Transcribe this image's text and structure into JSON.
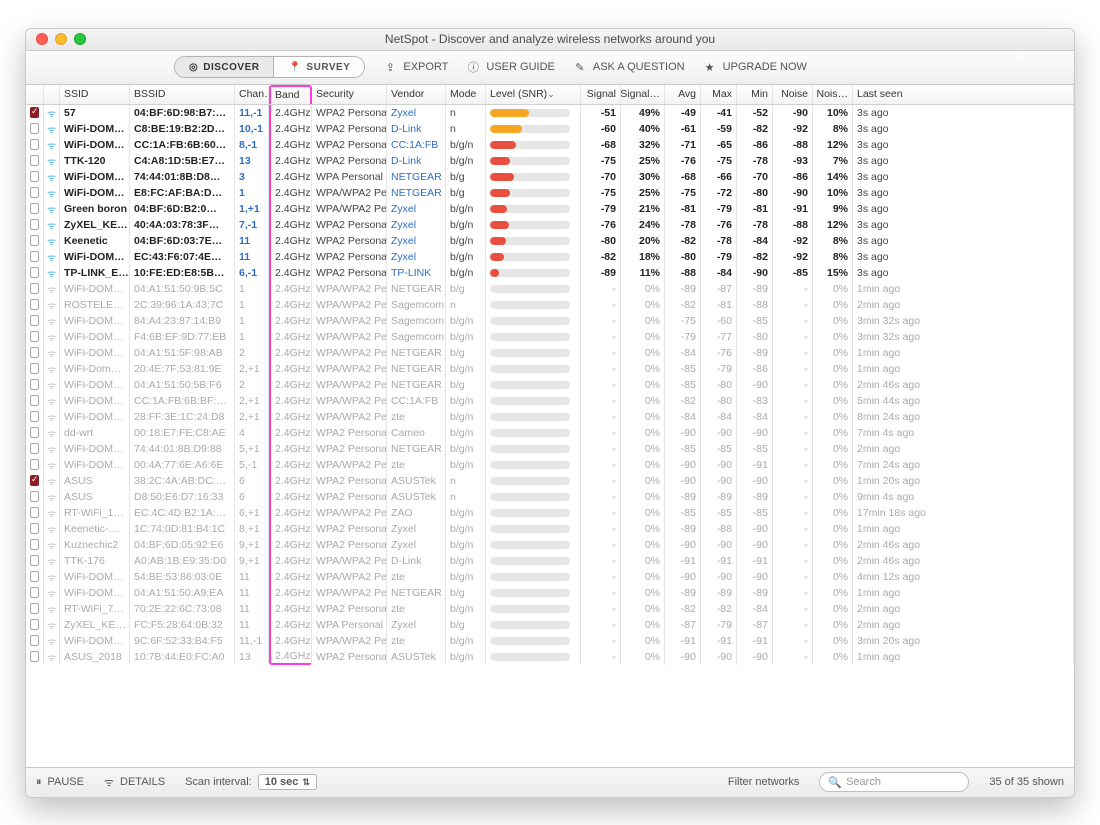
{
  "title": "NetSpot - Discover and analyze wireless networks around you",
  "toolbar": {
    "discover": "DISCOVER",
    "survey": "SURVEY",
    "export": "EXPORT",
    "userguide": "USER GUIDE",
    "ask": "ASK A QUESTION",
    "upgrade": "UPGRADE NOW"
  },
  "columns": {
    "ssid": "SSID",
    "bssid": "BSSID",
    "chan": "Chan…",
    "band": "Band",
    "security": "Security",
    "vendor": "Vendor",
    "mode": "Mode",
    "level": "Level (SNR)",
    "signal": "Signal",
    "signalp": "Signal…",
    "avg": "Avg",
    "max": "Max",
    "min": "Min",
    "noise": "Noise",
    "noisep": "Nois…",
    "last": "Last seen"
  },
  "footer": {
    "pause": "PAUSE",
    "details": "DETAILS",
    "scan_interval_label": "Scan interval:",
    "scan_interval_value": "10 sec",
    "filter_label": "Filter networks",
    "search_placeholder": "Search",
    "shown": "35 of 35 shown"
  },
  "rows": [
    {
      "chk": true,
      "ssid": "57",
      "bssid": "04:BF:6D:98:B7:…",
      "chan": "11,-1",
      "band": "2.4GHz",
      "sec": "WPA2 Personal",
      "vendor": "Zyxel",
      "mode": "n",
      "signal": -51,
      "spct": "49%",
      "avg": -49,
      "max": -41,
      "min": -52,
      "noise": -90,
      "noisep": "10%",
      "last": "3s ago",
      "active": true,
      "bar": 49,
      "color": "#f5a623"
    },
    {
      "chk": false,
      "ssid": "WiFi-DOM…",
      "bssid": "C8:BE:19:B2:2D…",
      "chan": "10,-1",
      "band": "2.4GHz",
      "sec": "WPA2 Personal",
      "vendor": "D-Link",
      "mode": "n",
      "signal": -60,
      "spct": "40%",
      "avg": -61,
      "max": -59,
      "min": -82,
      "noise": -92,
      "noisep": "8%",
      "last": "3s ago",
      "active": true,
      "bar": 40,
      "color": "#f5a623"
    },
    {
      "chk": false,
      "ssid": "WiFi-DOM…",
      "bssid": "CC:1A:FB:6B:60…",
      "chan": "8,-1",
      "band": "2.4GHz",
      "sec": "WPA2 Personal",
      "vendor": "CC:1A:FB",
      "mode": "b/g/n",
      "signal": -68,
      "spct": "32%",
      "avg": -71,
      "max": -65,
      "min": -86,
      "noise": -88,
      "noisep": "12%",
      "last": "3s ago",
      "active": true,
      "bar": 32,
      "color": "#e94f3e"
    },
    {
      "chk": false,
      "ssid": "TTK-120",
      "bssid": "C4:A8:1D:5B:E7…",
      "chan": "13",
      "band": "2.4GHz",
      "sec": "WPA2 Personal",
      "vendor": "D-Link",
      "mode": "b/g/n",
      "signal": -75,
      "spct": "25%",
      "avg": -76,
      "max": -75,
      "min": -78,
      "noise": -93,
      "noisep": "7%",
      "last": "3s ago",
      "active": true,
      "bar": 25,
      "color": "#e94f3e"
    },
    {
      "chk": false,
      "ssid": "WiFi-DOM…",
      "bssid": "74:44:01:8B:D8…",
      "chan": "3",
      "band": "2.4GHz",
      "sec": "WPA Personal",
      "vendor": "NETGEAR",
      "mode": "b/g",
      "signal": -70,
      "spct": "30%",
      "avg": -68,
      "max": -66,
      "min": -70,
      "noise": -86,
      "noisep": "14%",
      "last": "3s ago",
      "active": true,
      "bar": 30,
      "color": "#e94f3e"
    },
    {
      "chk": false,
      "ssid": "WiFi-DOM…",
      "bssid": "E8:FC:AF:BA:D…",
      "chan": "1",
      "band": "2.4GHz",
      "sec": "WPA/WPA2 Pe…",
      "vendor": "NETGEAR",
      "mode": "b/g",
      "signal": -75,
      "spct": "25%",
      "avg": -75,
      "max": -72,
      "min": -80,
      "noise": -90,
      "noisep": "10%",
      "last": "3s ago",
      "active": true,
      "bar": 25,
      "color": "#e94f3e"
    },
    {
      "chk": false,
      "ssid": "Green boron",
      "bssid": "04:BF:6D:B2:0…",
      "chan": "1,+1",
      "band": "2.4GHz",
      "sec": "WPA/WPA2 Pe…",
      "vendor": "Zyxel",
      "mode": "b/g/n",
      "signal": -79,
      "spct": "21%",
      "avg": -81,
      "max": -79,
      "min": -81,
      "noise": -91,
      "noisep": "9%",
      "last": "3s ago",
      "active": true,
      "bar": 21,
      "color": "#e94f3e"
    },
    {
      "chk": false,
      "ssid": "ZyXEL_KE…",
      "bssid": "40:4A:03:78:3F…",
      "chan": "7,-1",
      "band": "2.4GHz",
      "sec": "WPA2 Personal",
      "vendor": "Zyxel",
      "mode": "b/g/n",
      "signal": -76,
      "spct": "24%",
      "avg": -78,
      "max": -76,
      "min": -78,
      "noise": -88,
      "noisep": "12%",
      "last": "3s ago",
      "active": true,
      "bar": 24,
      "color": "#e94f3e"
    },
    {
      "chk": false,
      "ssid": "Keenetic",
      "bssid": "04:BF:6D:03:7E…",
      "chan": "11",
      "band": "2.4GHz",
      "sec": "WPA2 Personal",
      "vendor": "Zyxel",
      "mode": "b/g/n",
      "signal": -80,
      "spct": "20%",
      "avg": -82,
      "max": -78,
      "min": -84,
      "noise": -92,
      "noisep": "8%",
      "last": "3s ago",
      "active": true,
      "bar": 20,
      "color": "#e94f3e"
    },
    {
      "chk": false,
      "ssid": "WiFi-DOM…",
      "bssid": "EC:43:F6:07:4E…",
      "chan": "11",
      "band": "2.4GHz",
      "sec": "WPA2 Personal",
      "vendor": "Zyxel",
      "mode": "b/g/n",
      "signal": -82,
      "spct": "18%",
      "avg": -80,
      "max": -79,
      "min": -82,
      "noise": -92,
      "noisep": "8%",
      "last": "3s ago",
      "active": true,
      "bar": 18,
      "color": "#e94f3e"
    },
    {
      "chk": false,
      "ssid": "TP-LINK_E…",
      "bssid": "10:FE:ED:E8:5B…",
      "chan": "6,-1",
      "band": "2.4GHz",
      "sec": "WPA2 Personal",
      "vendor": "TP-LINK",
      "mode": "b/g/n",
      "signal": -89,
      "spct": "11%",
      "avg": -88,
      "max": -84,
      "min": -90,
      "noise": -85,
      "noisep": "15%",
      "last": "3s ago",
      "active": true,
      "bar": 11,
      "color": "#e94f3e"
    },
    {
      "chk": false,
      "ssid": "WiFi-DOM…",
      "bssid": "04:A1:51:50:9B:5C",
      "chan": "1",
      "band": "2.4GHz",
      "sec": "WPA/WPA2 Per…",
      "vendor": "NETGEAR",
      "mode": "b/g",
      "signal": "-",
      "spct": "0%",
      "avg": -89,
      "max": -87,
      "min": -89,
      "noise": "-",
      "noisep": "0%",
      "last": "1min ago",
      "active": false,
      "bar": 0
    },
    {
      "chk": false,
      "ssid": "ROSTELE…",
      "bssid": "2C:39:96:1A:43:7C",
      "chan": "1",
      "band": "2.4GHz",
      "sec": "WPA/WPA2 Per…",
      "vendor": "Sagemcom",
      "mode": "n",
      "signal": "-",
      "spct": "0%",
      "avg": -82,
      "max": -81,
      "min": -88,
      "noise": "-",
      "noisep": "0%",
      "last": "2min ago",
      "active": false,
      "bar": 0
    },
    {
      "chk": false,
      "ssid": "WiFi-DOM…",
      "bssid": "84:A4:23:87:14:B9",
      "chan": "1",
      "band": "2.4GHz",
      "sec": "WPA/WPA2 Per…",
      "vendor": "Sagemcom",
      "mode": "b/g/n",
      "signal": "-",
      "spct": "0%",
      "avg": -75,
      "max": -60,
      "min": -85,
      "noise": "-",
      "noisep": "0%",
      "last": "3min 32s ago",
      "active": false,
      "bar": 0
    },
    {
      "chk": false,
      "ssid": "WiFi-DOM…",
      "bssid": "F4:6B:EF:9D:77:EB",
      "chan": "1",
      "band": "2.4GHz",
      "sec": "WPA/WPA2 Per…",
      "vendor": "Sagemcom",
      "mode": "b/g/n",
      "signal": "-",
      "spct": "0%",
      "avg": -79,
      "max": -77,
      "min": -80,
      "noise": "-",
      "noisep": "0%",
      "last": "3min 32s ago",
      "active": false,
      "bar": 0
    },
    {
      "chk": false,
      "ssid": "WiFi-DOM…",
      "bssid": "04:A1:51:5F:98:AB",
      "chan": "2",
      "band": "2.4GHz",
      "sec": "WPA/WPA2 Per…",
      "vendor": "NETGEAR",
      "mode": "b/g",
      "signal": "-",
      "spct": "0%",
      "avg": -84,
      "max": -76,
      "min": -89,
      "noise": "-",
      "noisep": "0%",
      "last": "1min ago",
      "active": false,
      "bar": 0
    },
    {
      "chk": false,
      "ssid": "WiFi-Dom…",
      "bssid": "20:4E:7F:53:81:9E",
      "chan": "2,+1",
      "band": "2.4GHz",
      "sec": "WPA/WPA2 Per…",
      "vendor": "NETGEAR",
      "mode": "b/g/n",
      "signal": "-",
      "spct": "0%",
      "avg": -85,
      "max": -79,
      "min": -86,
      "noise": "-",
      "noisep": "0%",
      "last": "1min ago",
      "active": false,
      "bar": 0
    },
    {
      "chk": false,
      "ssid": "WiFi-DOM…",
      "bssid": "04:A1:51:50:5B:F6",
      "chan": "2",
      "band": "2.4GHz",
      "sec": "WPA/WPA2 Per…",
      "vendor": "NETGEAR",
      "mode": "b/g",
      "signal": "-",
      "spct": "0%",
      "avg": -85,
      "max": -80,
      "min": -90,
      "noise": "-",
      "noisep": "0%",
      "last": "2min 46s ago",
      "active": false,
      "bar": 0
    },
    {
      "chk": false,
      "ssid": "WiFi-DOM…",
      "bssid": "CC:1A:FB:6B:BF:…",
      "chan": "2,+1",
      "band": "2.4GHz",
      "sec": "WPA/WPA2 Per…",
      "vendor": "CC:1A:FB",
      "mode": "b/g/n",
      "signal": "-",
      "spct": "0%",
      "avg": -82,
      "max": -80,
      "min": -83,
      "noise": "-",
      "noisep": "0%",
      "last": "5min 44s ago",
      "active": false,
      "bar": 0
    },
    {
      "chk": false,
      "ssid": "WiFi-DOM…",
      "bssid": "28:FF:3E:1C:24:D8",
      "chan": "2,+1",
      "band": "2.4GHz",
      "sec": "WPA/WPA2 Per…",
      "vendor": "zte",
      "mode": "b/g/n",
      "signal": "-",
      "spct": "0%",
      "avg": -84,
      "max": -84,
      "min": -84,
      "noise": "-",
      "noisep": "0%",
      "last": "8min 24s ago",
      "active": false,
      "bar": 0
    },
    {
      "chk": false,
      "ssid": "dd-wrt",
      "bssid": "00:18:E7:FE:C8:AE",
      "chan": "4",
      "band": "2.4GHz",
      "sec": "WPA2 Personal",
      "vendor": "Cameo",
      "mode": "b/g/n",
      "signal": "-",
      "spct": "0%",
      "avg": -90,
      "max": -90,
      "min": -90,
      "noise": "-",
      "noisep": "0%",
      "last": "7min 4s ago",
      "active": false,
      "bar": 0
    },
    {
      "chk": false,
      "ssid": "WiFi-DOM…",
      "bssid": "74:44:01:8B:D9:88",
      "chan": "5,+1",
      "band": "2.4GHz",
      "sec": "WPA2 Personal",
      "vendor": "NETGEAR",
      "mode": "b/g/n",
      "signal": "-",
      "spct": "0%",
      "avg": -85,
      "max": -85,
      "min": -85,
      "noise": "-",
      "noisep": "0%",
      "last": "2min ago",
      "active": false,
      "bar": 0
    },
    {
      "chk": false,
      "ssid": "WiFi-DOM…",
      "bssid": "00:4A:77:6E:A6:6E",
      "chan": "5,-1",
      "band": "2.4GHz",
      "sec": "WPA/WPA2 Per…",
      "vendor": "zte",
      "mode": "b/g/n",
      "signal": "-",
      "spct": "0%",
      "avg": -90,
      "max": -90,
      "min": -91,
      "noise": "-",
      "noisep": "0%",
      "last": "7min 24s ago",
      "active": false,
      "bar": 0
    },
    {
      "chk": true,
      "ssid": "ASUS",
      "bssid": "38:2C:4A:AB:DC:…",
      "chan": "6",
      "band": "2.4GHz",
      "sec": "WPA2 Personal",
      "vendor": "ASUSTek",
      "mode": "n",
      "signal": "-",
      "spct": "0%",
      "avg": -90,
      "max": -90,
      "min": -90,
      "noise": "-",
      "noisep": "0%",
      "last": "1min 20s ago",
      "active": false,
      "bar": 0
    },
    {
      "chk": false,
      "ssid": "ASUS",
      "bssid": "D8:50:E6:D7:16:33",
      "chan": "6",
      "band": "2.4GHz",
      "sec": "WPA2 Personal",
      "vendor": "ASUSTek",
      "mode": "n",
      "signal": "-",
      "spct": "0%",
      "avg": -89,
      "max": -89,
      "min": -89,
      "noise": "-",
      "noisep": "0%",
      "last": "9min 4s ago",
      "active": false,
      "bar": 0
    },
    {
      "chk": false,
      "ssid": "RT-WiFi_1…",
      "bssid": "EC:4C:4D:B2:1A:…",
      "chan": "6,+1",
      "band": "2.4GHz",
      "sec": "WPA/WPA2 Per…",
      "vendor": "ZAO",
      "mode": "b/g/n",
      "signal": "-",
      "spct": "0%",
      "avg": -85,
      "max": -85,
      "min": -85,
      "noise": "-",
      "noisep": "0%",
      "last": "17min 18s ago",
      "active": false,
      "bar": 0
    },
    {
      "chk": false,
      "ssid": "Keenetic-…",
      "bssid": "1C:74:0D:81:B4:1C",
      "chan": "8,+1",
      "band": "2.4GHz",
      "sec": "WPA2 Personal",
      "vendor": "Zyxel",
      "mode": "b/g/n",
      "signal": "-",
      "spct": "0%",
      "avg": -89,
      "max": -88,
      "min": -90,
      "noise": "-",
      "noisep": "0%",
      "last": "1min ago",
      "active": false,
      "bar": 0
    },
    {
      "chk": false,
      "ssid": "Kuznechic2",
      "bssid": "04:BF:6D:05:92:E6",
      "chan": "9,+1",
      "band": "2.4GHz",
      "sec": "WPA2 Personal",
      "vendor": "Zyxel",
      "mode": "b/g/n",
      "signal": "-",
      "spct": "0%",
      "avg": -90,
      "max": -90,
      "min": -90,
      "noise": "-",
      "noisep": "0%",
      "last": "2min 46s ago",
      "active": false,
      "bar": 0
    },
    {
      "chk": false,
      "ssid": "TTK-176",
      "bssid": "A0:AB:1B:E9:35:D0",
      "chan": "9,+1",
      "band": "2.4GHz",
      "sec": "WPA/WPA2 Per…",
      "vendor": "D-Link",
      "mode": "b/g/n",
      "signal": "-",
      "spct": "0%",
      "avg": -91,
      "max": -91,
      "min": -91,
      "noise": "-",
      "noisep": "0%",
      "last": "2min 46s ago",
      "active": false,
      "bar": 0
    },
    {
      "chk": false,
      "ssid": "WiFi-DOM…",
      "bssid": "54:BE:53:86:03:0E",
      "chan": "11",
      "band": "2.4GHz",
      "sec": "WPA/WPA2 Per…",
      "vendor": "zte",
      "mode": "b/g/n",
      "signal": "-",
      "spct": "0%",
      "avg": -90,
      "max": -90,
      "min": -90,
      "noise": "-",
      "noisep": "0%",
      "last": "4min 12s ago",
      "active": false,
      "bar": 0
    },
    {
      "chk": false,
      "ssid": "WiFi-DOM…",
      "bssid": "04:A1:51:50:A9:EA",
      "chan": "11",
      "band": "2.4GHz",
      "sec": "WPA/WPA2 Per…",
      "vendor": "NETGEAR",
      "mode": "b/g",
      "signal": "-",
      "spct": "0%",
      "avg": -89,
      "max": -89,
      "min": -89,
      "noise": "-",
      "noisep": "0%",
      "last": "1min ago",
      "active": false,
      "bar": 0
    },
    {
      "chk": false,
      "ssid": "RT-WiFi_7…",
      "bssid": "70:2E:22:6C:73:08",
      "chan": "11",
      "band": "2.4GHz",
      "sec": "WPA2 Personal",
      "vendor": "zte",
      "mode": "b/g/n",
      "signal": "-",
      "spct": "0%",
      "avg": -82,
      "max": -82,
      "min": -84,
      "noise": "-",
      "noisep": "0%",
      "last": "2min ago",
      "active": false,
      "bar": 0
    },
    {
      "chk": false,
      "ssid": "ZyXEL_KE…",
      "bssid": "FC:F5:28:64:0B:32",
      "chan": "11",
      "band": "2.4GHz",
      "sec": "WPA Personal",
      "vendor": "Zyxel",
      "mode": "b/g",
      "signal": "-",
      "spct": "0%",
      "avg": -87,
      "max": -79,
      "min": -87,
      "noise": "-",
      "noisep": "0%",
      "last": "2min ago",
      "active": false,
      "bar": 0
    },
    {
      "chk": false,
      "ssid": "WiFi-DOM…",
      "bssid": "9C:6F:52:33:B4:F5",
      "chan": "11,-1",
      "band": "2.4GHz",
      "sec": "WPA/WPA2 Per…",
      "vendor": "zte",
      "mode": "b/g/n",
      "signal": "-",
      "spct": "0%",
      "avg": -91,
      "max": -91,
      "min": -91,
      "noise": "-",
      "noisep": "0%",
      "last": "3min 20s ago",
      "active": false,
      "bar": 0
    },
    {
      "chk": false,
      "ssid": "ASUS_2018",
      "bssid": "10:7B:44:E0:FC:A0",
      "chan": "13",
      "band": "2.4GHz",
      "sec": "WPA2 Personal",
      "vendor": "ASUSTek",
      "mode": "b/g/n",
      "signal": "-",
      "spct": "0%",
      "avg": -90,
      "max": -90,
      "min": -90,
      "noise": "-",
      "noisep": "0%",
      "last": "1min ago",
      "active": false,
      "bar": 0
    }
  ]
}
